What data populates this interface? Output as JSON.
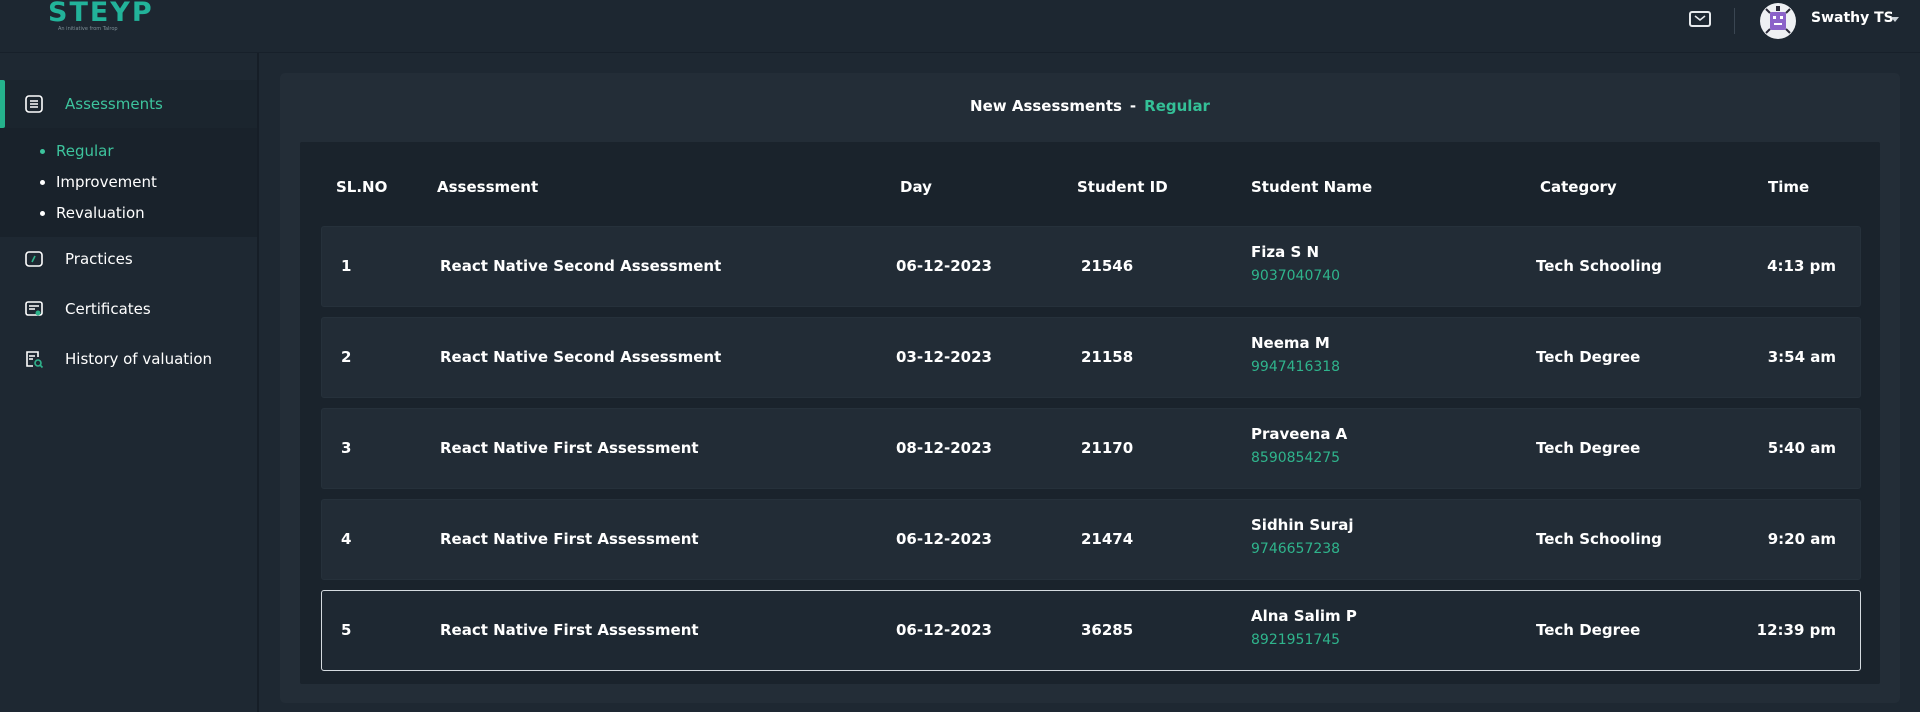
{
  "brand": {
    "logo_text": "STEYP",
    "logo_tagline": "An initiative from Talrop"
  },
  "header": {
    "user_name": "Swathy TS",
    "icons": [
      "mail-icon",
      "avatar",
      "chevron-down-icon"
    ]
  },
  "sidebar": {
    "items": [
      {
        "label": "Assessments",
        "icon": "document-list-icon",
        "active": true
      },
      {
        "label": "Practices",
        "icon": "practice-screen-icon"
      },
      {
        "label": "Certificates",
        "icon": "certificate-icon"
      },
      {
        "label": "History of valuation",
        "icon": "history-search-icon"
      }
    ],
    "submenu": [
      {
        "label": "Regular",
        "active": true
      },
      {
        "label": "Improvement"
      },
      {
        "label": "Revaluation"
      }
    ]
  },
  "main": {
    "title": "New Assessments",
    "title_separator": "-",
    "title_filter": "Regular",
    "columns": [
      "SL.NO",
      "Assessment",
      "Day",
      "Student ID",
      "Student Name",
      "Category",
      "Time"
    ],
    "rows": [
      {
        "sl": "1",
        "assessment": "React Native Second Assessment",
        "day": "06-12-2023",
        "student_id": "21546",
        "name": "Fiza S N",
        "phone": "9037040740",
        "category": "Tech Schooling",
        "time": "4:13 pm"
      },
      {
        "sl": "2",
        "assessment": "React Native Second Assessment",
        "day": "03-12-2023",
        "student_id": "21158",
        "name": "Neema M",
        "phone": "9947416318",
        "category": "Tech Degree",
        "time": "3:54 am"
      },
      {
        "sl": "3",
        "assessment": "React Native First Assessment",
        "day": "08-12-2023",
        "student_id": "21170",
        "name": "Praveena A",
        "phone": "8590854275",
        "category": "Tech Degree",
        "time": "5:40 am"
      },
      {
        "sl": "4",
        "assessment": "React Native First Assessment",
        "day": "06-12-2023",
        "student_id": "21474",
        "name": "Sidhin Suraj",
        "phone": "9746657238",
        "category": "Tech Schooling",
        "time": "9:20 am"
      },
      {
        "sl": "5",
        "assessment": "React Native First Assessment",
        "day": "06-12-2023",
        "student_id": "36285",
        "name": "Alna Salim P",
        "phone": "8921951745",
        "category": "Tech Degree",
        "time": "12:39 pm"
      }
    ]
  },
  "colors": {
    "accent": "#34c097",
    "background": "#1e2832",
    "panel": "#232d37",
    "row": "#222c36"
  }
}
